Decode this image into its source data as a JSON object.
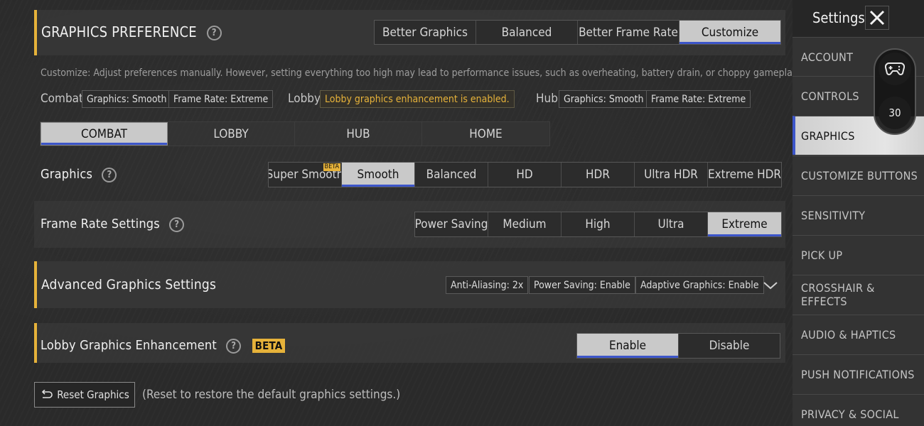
{
  "graphics_preference": {
    "title": "GRAPHICS PREFERENCE",
    "presets": [
      "Better Graphics",
      "Balanced",
      "Better Frame Rate",
      "Customize"
    ],
    "active_preset": 3,
    "description": "Customize: Adjust preferences manually. However, setting everything too high may lead to performance issues, such as overheating, battery drain, or choppy gameplay.",
    "combat_label": "Combat",
    "combat_graphics": "Graphics: Smooth",
    "combat_frame_rate": "Frame Rate: Extreme",
    "lobby_label": "Lobby",
    "lobby_status": "Lobby graphics enhancement is enabled.",
    "hub_label": "Hub",
    "hub_graphics": "Graphics: Smooth",
    "hub_frame_rate": "Frame Rate: Extreme"
  },
  "mode_tabs": [
    "COMBAT",
    "LOBBY",
    "HUB",
    "HOME"
  ],
  "graphics": {
    "label": "Graphics",
    "options": [
      "Super Smooth",
      "Smooth",
      "Balanced",
      "HD",
      "HDR",
      "Ultra HDR",
      "Extreme HDR"
    ],
    "beta_badge": "BETA"
  },
  "frame_rate": {
    "label": "Frame Rate Settings",
    "options": [
      "Power Saving",
      "Medium",
      "High",
      "Ultra",
      "Extreme"
    ]
  },
  "advanced": {
    "title": "Advanced Graphics Settings",
    "anti_aliasing": "Anti-Aliasing: 2x",
    "power_saving": "Power Saving: Enable",
    "adaptive": "Adaptive Graphics: Enable"
  },
  "lobby_enhancement": {
    "title": "Lobby Graphics Enhancement",
    "beta": "BETA",
    "options": [
      "Enable",
      "Disable"
    ]
  },
  "reset": {
    "button": "Reset Graphics",
    "hint": "(Reset to restore the default graphics settings.)"
  },
  "sidebar": {
    "title": "Settings",
    "fps_value": "30",
    "items": [
      "ACCOUNT",
      "CONTROLS",
      "GRAPHICS",
      "CUSTOMIZE BUTTONS",
      "SENSITIVITY",
      "PICK UP",
      "CROSSHAIR & EFFECTS",
      "AUDIO & HAPTICS",
      "PUSH NOTIFICATIONS",
      "PRIVACY & SOCIAL"
    ]
  },
  "colors": {
    "accent": "#e6b23a",
    "selected_underline": "#3c55c9",
    "selected_bg": "#c9c9c9"
  }
}
